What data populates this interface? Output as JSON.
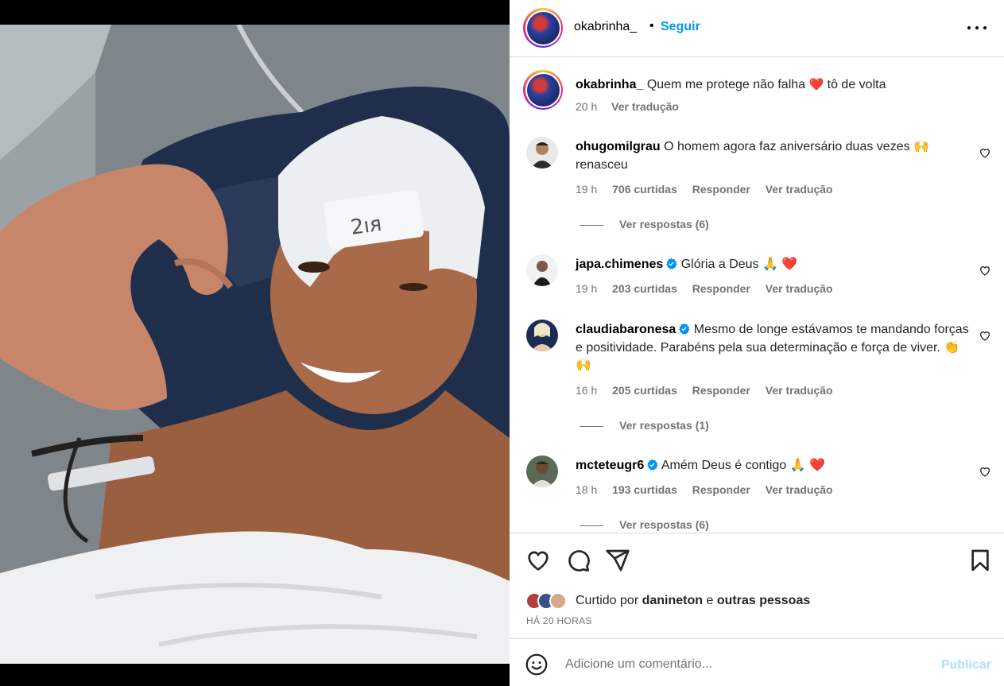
{
  "post": {
    "author": "okabrinha_",
    "separator": "•",
    "follow_label": "Seguir",
    "more_icon": "more-options-icon"
  },
  "caption": {
    "author": "okabrinha_",
    "text_before": "Quem me protege não falha",
    "emoji": "❤️",
    "text_after": "tô de volta",
    "time": "20 h",
    "translate": "Ver tradução"
  },
  "comments": [
    {
      "user": "ohugomilgrau",
      "verified": false,
      "text": "O homem agora faz aniversário duas vezes 🙌 renasceu",
      "time": "19 h",
      "likes": "706 curtidas",
      "reply": "Responder",
      "translate": "Ver tradução",
      "replies": "Ver respostas (6)"
    },
    {
      "user": "japa.chimenes",
      "verified": true,
      "text": "Glória a Deus 🙏 ❤️",
      "time": "19 h",
      "likes": "203 curtidas",
      "reply": "Responder",
      "translate": "Ver tradução",
      "replies": ""
    },
    {
      "user": "claudiabaronesa",
      "verified": true,
      "text": "Mesmo de longe estávamos te mandando forças e positividade. Parabéns pela sua determinação e força de viver. 👏 🙌",
      "time": "16 h",
      "likes": "205 curtidas",
      "reply": "Responder",
      "translate": "Ver tradução",
      "replies": "Ver respostas (1)"
    },
    {
      "user": "mcteteugr6",
      "verified": true,
      "text": "Amém Deus é contigo 🙏 ❤️",
      "time": "18 h",
      "likes": "193 curtidas",
      "reply": "Responder",
      "translate": "Ver tradução",
      "replies": "Ver respostas (6)"
    }
  ],
  "actions": {
    "like_icon": "heart-icon",
    "comment_icon": "comment-icon",
    "share_icon": "share-icon",
    "save_icon": "bookmark-icon"
  },
  "likes": {
    "prefix": "Curtido por",
    "user": "danineton",
    "conj": "e",
    "others": "outras pessoas"
  },
  "posted": "HÁ 20 HORAS",
  "add_comment": {
    "placeholder": "Adicione um comentário...",
    "publish": "Publicar"
  },
  "colors": {
    "link": "#0095f6",
    "publish_disabled": "#b2dffc",
    "secondary_text": "#737373",
    "border": "#dbdbdb",
    "heart_red": "#ed4956"
  }
}
